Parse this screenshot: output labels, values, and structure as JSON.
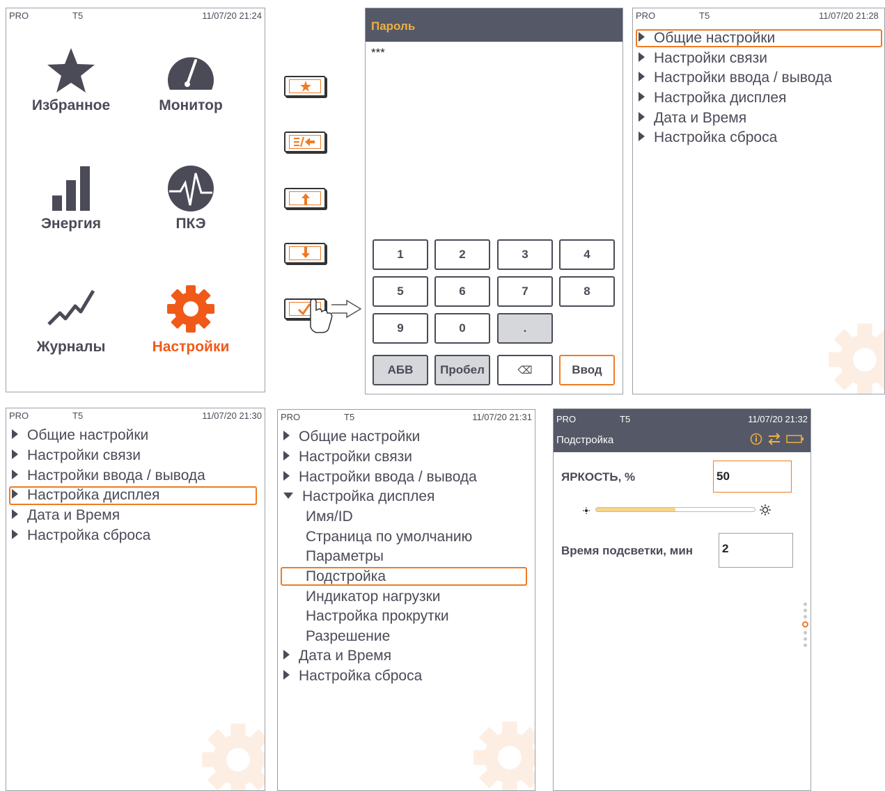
{
  "status_bar": {
    "device": "PRO",
    "channel": "T5"
  },
  "main_menu": {
    "time": "11/07/20 21:24",
    "tiles": [
      {
        "label": "Избранное",
        "icon": "star-icon"
      },
      {
        "label": "Монитор",
        "icon": "gauge-icon"
      },
      {
        "label": "Энергия",
        "icon": "bar-chart-icon"
      },
      {
        "label": "ПКЭ",
        "icon": "pulse-icon"
      },
      {
        "label": "Журналы",
        "icon": "trend-line-icon"
      },
      {
        "label": "Настройки",
        "icon": "gear-icon",
        "active": true
      }
    ]
  },
  "side_buttons": [
    "star-button",
    "menu-back-button",
    "up-arrow-button",
    "down-arrow-button",
    "enter-check-button"
  ],
  "password_dialog": {
    "title": "Пароль",
    "value": "***",
    "keys": [
      "1",
      "2",
      "3",
      "4",
      "5",
      "6",
      "7",
      "8",
      "9",
      "0",
      "."
    ],
    "bottom_keys": {
      "abc": "АБВ",
      "space": "Пробел",
      "backspace": "⌫",
      "enter": "Ввод"
    }
  },
  "settings_menu_1": {
    "time": "11/07/20 21:28",
    "items": [
      "Общие настройки",
      "Настройки связи",
      "Настройки ввода / вывода",
      "Настройка дисплея",
      "Дата и Время",
      "Настройка сброса"
    ],
    "selected": 0
  },
  "settings_menu_2": {
    "time": "11/07/20 21:30",
    "items": [
      "Общие настройки",
      "Настройки связи",
      "Настройки ввода / вывода",
      "Настройка дисплея",
      "Дата и Время",
      "Настройка сброса"
    ],
    "selected": 3
  },
  "settings_menu_3": {
    "time": "11/07/20 21:31",
    "items_before": [
      "Общие настройки",
      "Настройки связи",
      "Настройки ввода / вывода"
    ],
    "expanded": "Настройка дисплея",
    "sub_items": [
      "Имя/ID",
      "Страница по умолчанию",
      "Параметры",
      "Подстройка",
      "Индикатор нагрузки",
      "Настройка прокрутки",
      "Разрешение"
    ],
    "items_after": [
      "Дата и Время",
      "Настройка сброса"
    ],
    "selected_sub": 3
  },
  "adjust_screen": {
    "time": "11/07/20 21:32",
    "title": "Подстройка",
    "brightness_label": "ЯРКОСТЬ, %",
    "brightness_value": "50",
    "brightness_level": 0.5,
    "backlight_label": "Время подсветки, мин",
    "backlight_value": "2",
    "page_dots": 7,
    "active_dot": 3
  },
  "colors": {
    "accent": "#f07a22",
    "text": "#4a4b57",
    "header": "#555866"
  }
}
